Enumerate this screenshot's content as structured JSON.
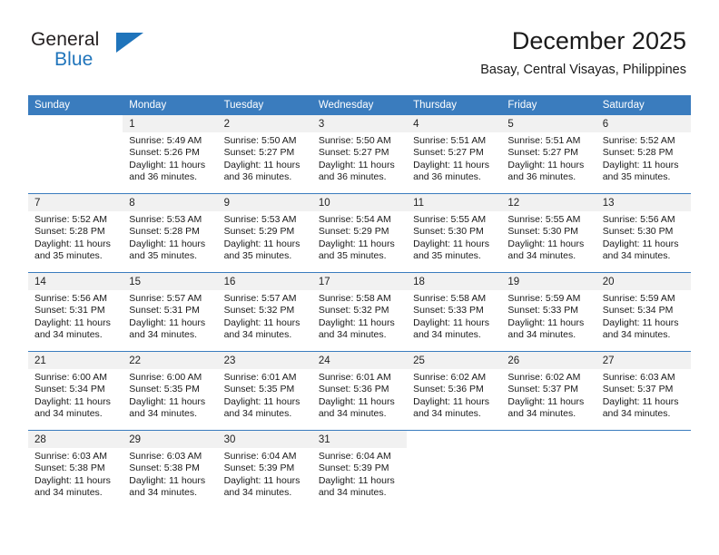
{
  "brand": {
    "name_part1": "General",
    "name_part2": "Blue"
  },
  "header": {
    "month_title": "December 2025",
    "location": "Basay, Central Visayas, Philippines"
  },
  "calendar": {
    "weekday_headers": [
      "Sunday",
      "Monday",
      "Tuesday",
      "Wednesday",
      "Thursday",
      "Friday",
      "Saturday"
    ],
    "accent_color": "#3a7cbe",
    "daynum_band_color": "#f1f1f1",
    "weeks": [
      [
        {
          "day": ""
        },
        {
          "day": "1",
          "sunrise": "Sunrise: 5:49 AM",
          "sunset": "Sunset: 5:26 PM",
          "daylight_line1": "Daylight: 11 hours",
          "daylight_line2": "and 36 minutes."
        },
        {
          "day": "2",
          "sunrise": "Sunrise: 5:50 AM",
          "sunset": "Sunset: 5:27 PM",
          "daylight_line1": "Daylight: 11 hours",
          "daylight_line2": "and 36 minutes."
        },
        {
          "day": "3",
          "sunrise": "Sunrise: 5:50 AM",
          "sunset": "Sunset: 5:27 PM",
          "daylight_line1": "Daylight: 11 hours",
          "daylight_line2": "and 36 minutes."
        },
        {
          "day": "4",
          "sunrise": "Sunrise: 5:51 AM",
          "sunset": "Sunset: 5:27 PM",
          "daylight_line1": "Daylight: 11 hours",
          "daylight_line2": "and 36 minutes."
        },
        {
          "day": "5",
          "sunrise": "Sunrise: 5:51 AM",
          "sunset": "Sunset: 5:27 PM",
          "daylight_line1": "Daylight: 11 hours",
          "daylight_line2": "and 36 minutes."
        },
        {
          "day": "6",
          "sunrise": "Sunrise: 5:52 AM",
          "sunset": "Sunset: 5:28 PM",
          "daylight_line1": "Daylight: 11 hours",
          "daylight_line2": "and 35 minutes."
        }
      ],
      [
        {
          "day": "7",
          "sunrise": "Sunrise: 5:52 AM",
          "sunset": "Sunset: 5:28 PM",
          "daylight_line1": "Daylight: 11 hours",
          "daylight_line2": "and 35 minutes."
        },
        {
          "day": "8",
          "sunrise": "Sunrise: 5:53 AM",
          "sunset": "Sunset: 5:28 PM",
          "daylight_line1": "Daylight: 11 hours",
          "daylight_line2": "and 35 minutes."
        },
        {
          "day": "9",
          "sunrise": "Sunrise: 5:53 AM",
          "sunset": "Sunset: 5:29 PM",
          "daylight_line1": "Daylight: 11 hours",
          "daylight_line2": "and 35 minutes."
        },
        {
          "day": "10",
          "sunrise": "Sunrise: 5:54 AM",
          "sunset": "Sunset: 5:29 PM",
          "daylight_line1": "Daylight: 11 hours",
          "daylight_line2": "and 35 minutes."
        },
        {
          "day": "11",
          "sunrise": "Sunrise: 5:55 AM",
          "sunset": "Sunset: 5:30 PM",
          "daylight_line1": "Daylight: 11 hours",
          "daylight_line2": "and 35 minutes."
        },
        {
          "day": "12",
          "sunrise": "Sunrise: 5:55 AM",
          "sunset": "Sunset: 5:30 PM",
          "daylight_line1": "Daylight: 11 hours",
          "daylight_line2": "and 34 minutes."
        },
        {
          "day": "13",
          "sunrise": "Sunrise: 5:56 AM",
          "sunset": "Sunset: 5:30 PM",
          "daylight_line1": "Daylight: 11 hours",
          "daylight_line2": "and 34 minutes."
        }
      ],
      [
        {
          "day": "14",
          "sunrise": "Sunrise: 5:56 AM",
          "sunset": "Sunset: 5:31 PM",
          "daylight_line1": "Daylight: 11 hours",
          "daylight_line2": "and 34 minutes."
        },
        {
          "day": "15",
          "sunrise": "Sunrise: 5:57 AM",
          "sunset": "Sunset: 5:31 PM",
          "daylight_line1": "Daylight: 11 hours",
          "daylight_line2": "and 34 minutes."
        },
        {
          "day": "16",
          "sunrise": "Sunrise: 5:57 AM",
          "sunset": "Sunset: 5:32 PM",
          "daylight_line1": "Daylight: 11 hours",
          "daylight_line2": "and 34 minutes."
        },
        {
          "day": "17",
          "sunrise": "Sunrise: 5:58 AM",
          "sunset": "Sunset: 5:32 PM",
          "daylight_line1": "Daylight: 11 hours",
          "daylight_line2": "and 34 minutes."
        },
        {
          "day": "18",
          "sunrise": "Sunrise: 5:58 AM",
          "sunset": "Sunset: 5:33 PM",
          "daylight_line1": "Daylight: 11 hours",
          "daylight_line2": "and 34 minutes."
        },
        {
          "day": "19",
          "sunrise": "Sunrise: 5:59 AM",
          "sunset": "Sunset: 5:33 PM",
          "daylight_line1": "Daylight: 11 hours",
          "daylight_line2": "and 34 minutes."
        },
        {
          "day": "20",
          "sunrise": "Sunrise: 5:59 AM",
          "sunset": "Sunset: 5:34 PM",
          "daylight_line1": "Daylight: 11 hours",
          "daylight_line2": "and 34 minutes."
        }
      ],
      [
        {
          "day": "21",
          "sunrise": "Sunrise: 6:00 AM",
          "sunset": "Sunset: 5:34 PM",
          "daylight_line1": "Daylight: 11 hours",
          "daylight_line2": "and 34 minutes."
        },
        {
          "day": "22",
          "sunrise": "Sunrise: 6:00 AM",
          "sunset": "Sunset: 5:35 PM",
          "daylight_line1": "Daylight: 11 hours",
          "daylight_line2": "and 34 minutes."
        },
        {
          "day": "23",
          "sunrise": "Sunrise: 6:01 AM",
          "sunset": "Sunset: 5:35 PM",
          "daylight_line1": "Daylight: 11 hours",
          "daylight_line2": "and 34 minutes."
        },
        {
          "day": "24",
          "sunrise": "Sunrise: 6:01 AM",
          "sunset": "Sunset: 5:36 PM",
          "daylight_line1": "Daylight: 11 hours",
          "daylight_line2": "and 34 minutes."
        },
        {
          "day": "25",
          "sunrise": "Sunrise: 6:02 AM",
          "sunset": "Sunset: 5:36 PM",
          "daylight_line1": "Daylight: 11 hours",
          "daylight_line2": "and 34 minutes."
        },
        {
          "day": "26",
          "sunrise": "Sunrise: 6:02 AM",
          "sunset": "Sunset: 5:37 PM",
          "daylight_line1": "Daylight: 11 hours",
          "daylight_line2": "and 34 minutes."
        },
        {
          "day": "27",
          "sunrise": "Sunrise: 6:03 AM",
          "sunset": "Sunset: 5:37 PM",
          "daylight_line1": "Daylight: 11 hours",
          "daylight_line2": "and 34 minutes."
        }
      ],
      [
        {
          "day": "28",
          "sunrise": "Sunrise: 6:03 AM",
          "sunset": "Sunset: 5:38 PM",
          "daylight_line1": "Daylight: 11 hours",
          "daylight_line2": "and 34 minutes."
        },
        {
          "day": "29",
          "sunrise": "Sunrise: 6:03 AM",
          "sunset": "Sunset: 5:38 PM",
          "daylight_line1": "Daylight: 11 hours",
          "daylight_line2": "and 34 minutes."
        },
        {
          "day": "30",
          "sunrise": "Sunrise: 6:04 AM",
          "sunset": "Sunset: 5:39 PM",
          "daylight_line1": "Daylight: 11 hours",
          "daylight_line2": "and 34 minutes."
        },
        {
          "day": "31",
          "sunrise": "Sunrise: 6:04 AM",
          "sunset": "Sunset: 5:39 PM",
          "daylight_line1": "Daylight: 11 hours",
          "daylight_line2": "and 34 minutes."
        },
        {
          "day": ""
        },
        {
          "day": ""
        },
        {
          "day": ""
        }
      ]
    ]
  }
}
